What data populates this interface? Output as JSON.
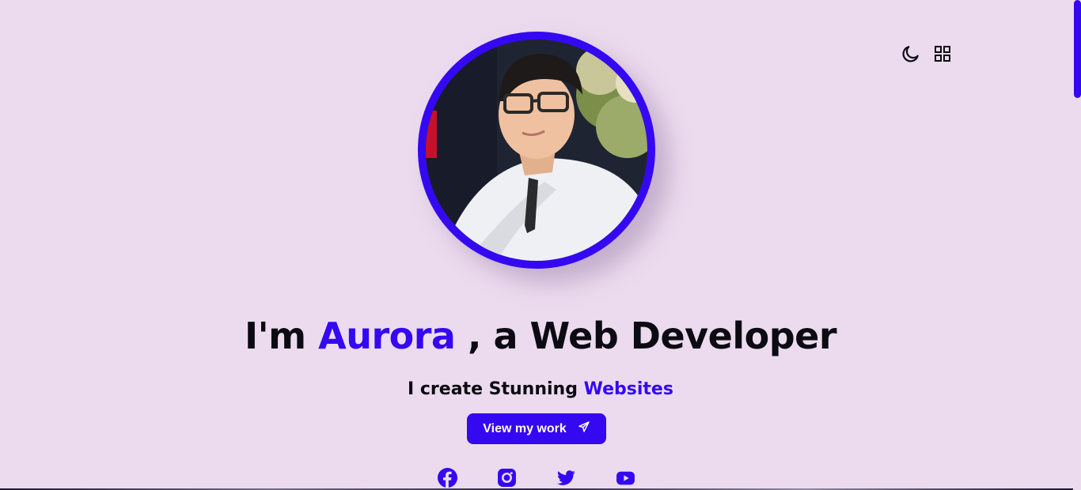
{
  "header": {
    "theme_toggle_icon": "moon-icon",
    "menu_icon": "grid-icon"
  },
  "hero": {
    "avatar": "profile-photo",
    "title_prefix": "I'm",
    "name": "Aurora",
    "title_suffix": ", a Web Developer",
    "subtitle_prefix": "I create Stunning",
    "subtitle_highlight": "Websites",
    "cta_label": "View my work",
    "cta_icon": "send-icon"
  },
  "social": [
    {
      "name": "facebook-icon"
    },
    {
      "name": "instagram-icon"
    },
    {
      "name": "twitter-icon"
    },
    {
      "name": "youtube-icon"
    }
  ],
  "colors": {
    "background": "#ecdbee",
    "accent": "#3508f2",
    "text": "#0c0a12"
  }
}
